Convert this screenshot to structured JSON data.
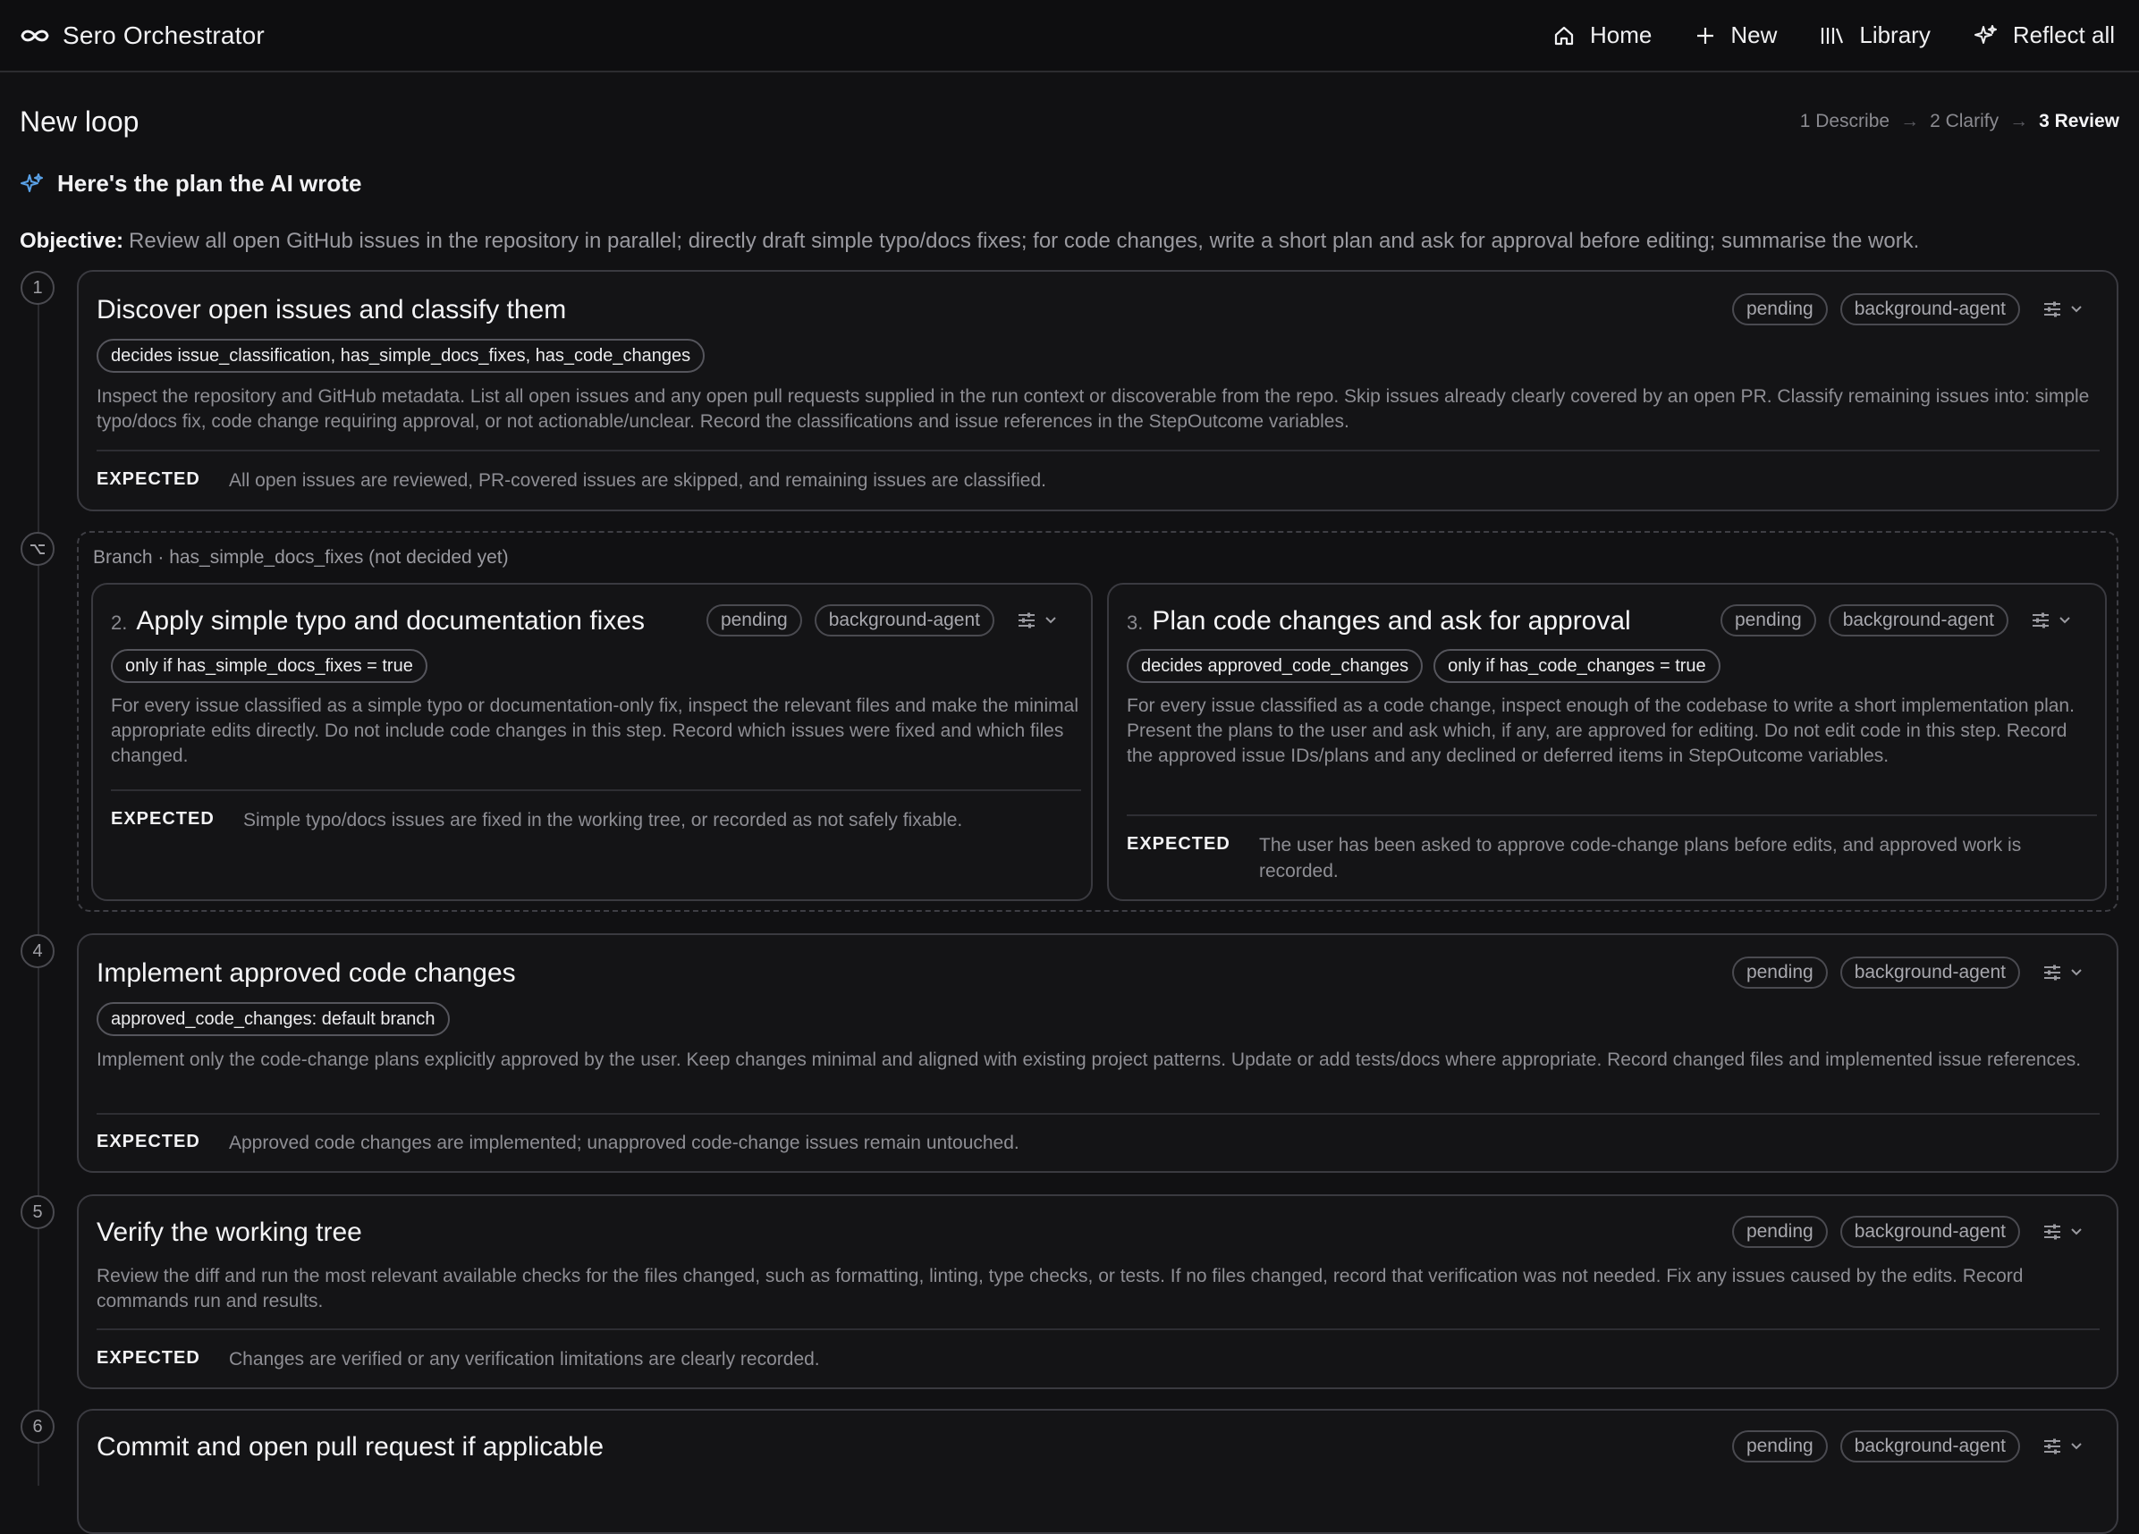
{
  "app": {
    "title": "Sero Orchestrator"
  },
  "nav": {
    "home": "Home",
    "new": "New",
    "library": "Library",
    "reflect": "Reflect all"
  },
  "page": {
    "title": "New loop"
  },
  "wizard": {
    "step1": "1 Describe",
    "step2": "2 Clarify",
    "step3": "3 Review"
  },
  "plan": {
    "header": "Here's the plan the AI wrote"
  },
  "objective": {
    "label": "Objective:",
    "text": "Review all open GitHub issues in the repository in parallel; directly draft simple typo/docs fixes; for code changes, write a short plan and ask for approval before editing; summarise the work."
  },
  "expected_label": "EXPECTED",
  "branch": {
    "label": "Branch · has_simple_docs_fixes (not decided yet)"
  },
  "steps": {
    "s1": {
      "num": "1",
      "title": "Discover open issues and classify them",
      "status": "pending",
      "agent": "background-agent",
      "chips": [
        "decides issue_classification, has_simple_docs_fixes, has_code_changes"
      ],
      "desc": "Inspect the repository and GitHub metadata. List all open issues and any open pull requests supplied in the run context or discoverable from the repo. Skip issues already clearly covered by an open PR. Classify remaining issues into: simple typo/docs fix, code change requiring approval, or not actionable/unclear. Record the classifications and issue references in the StepOutcome variables.",
      "expected": "All open issues are reviewed, PR-covered issues are skipped, and remaining issues are classified."
    },
    "s2": {
      "num": "2.",
      "title": "Apply simple typo and documentation fixes",
      "status": "pending",
      "agent": "background-agent",
      "chips": [
        "only if has_simple_docs_fixes = true"
      ],
      "desc": "For every issue classified as a simple typo or documentation-only fix, inspect the relevant files and make the minimal appropriate edits directly. Do not include code changes in this step. Record which issues were fixed and which files changed.",
      "expected": "Simple typo/docs issues are fixed in the working tree, or recorded as not safely fixable."
    },
    "s3": {
      "num": "3.",
      "title": "Plan code changes and ask for approval",
      "status": "pending",
      "agent": "background-agent",
      "chips": [
        "decides approved_code_changes",
        "only if has_code_changes = true"
      ],
      "desc": "For every issue classified as a code change, inspect enough of the codebase to write a short implementation plan. Present the plans to the user and ask which, if any, are approved for editing. Do not edit code in this step. Record the approved issue IDs/plans and any declined or deferred items in StepOutcome variables.",
      "expected": "The user has been asked to approve code-change plans before edits, and approved work is recorded."
    },
    "s4": {
      "num": "4",
      "title": "Implement approved code changes",
      "status": "pending",
      "agent": "background-agent",
      "chips": [
        "approved_code_changes: default branch"
      ],
      "desc": "Implement only the code-change plans explicitly approved by the user. Keep changes minimal and aligned with existing project patterns. Update or add tests/docs where appropriate. Record changed files and implemented issue references.",
      "expected": "Approved code changes are implemented; unapproved code-change issues remain untouched."
    },
    "s5": {
      "num": "5",
      "title": "Verify the working tree",
      "status": "pending",
      "agent": "background-agent",
      "desc": "Review the diff and run the most relevant available checks for the files changed, such as formatting, linting, type checks, or tests. If no files changed, record that verification was not needed. Fix any issues caused by the edits. Record commands run and results.",
      "expected": "Changes are verified or any verification limitations are clearly recorded."
    },
    "s6": {
      "num": "6",
      "title": "Commit and open pull request if applicable",
      "status": "pending",
      "agent": "background-agent"
    }
  }
}
